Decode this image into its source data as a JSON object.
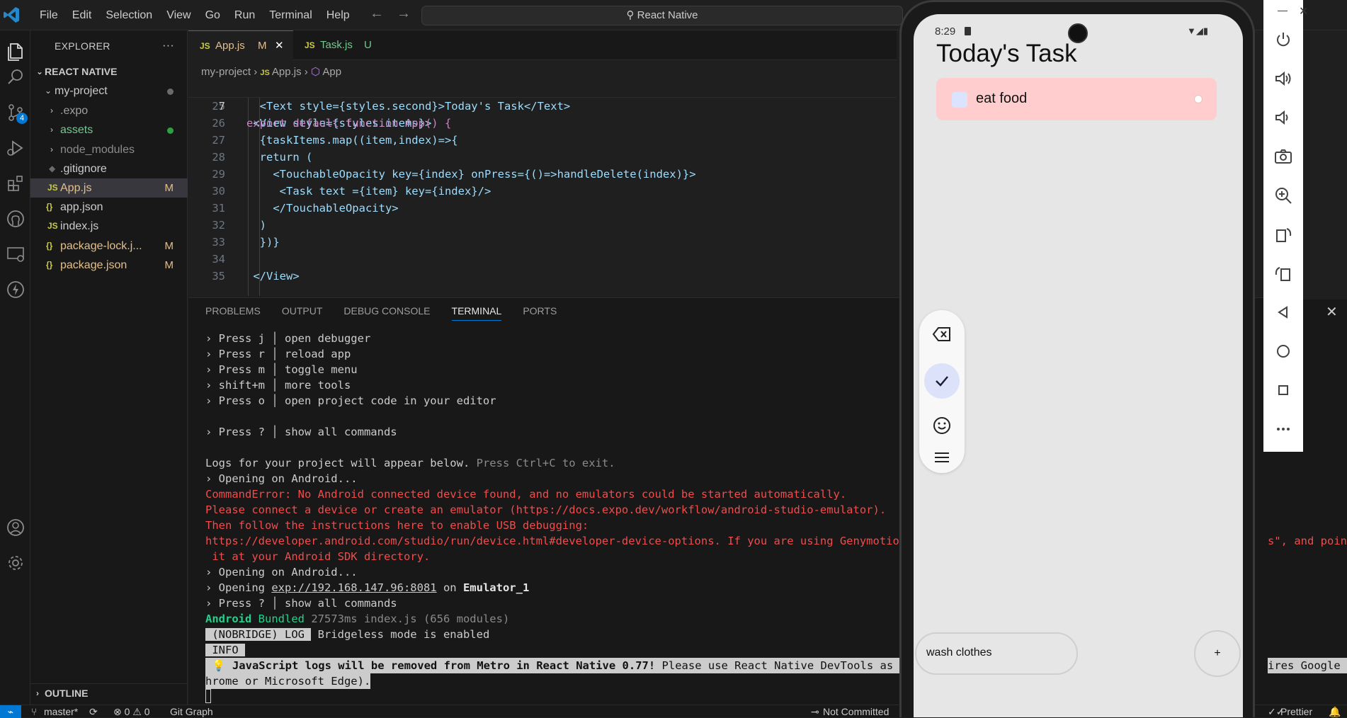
{
  "menu": [
    "File",
    "Edit",
    "Selection",
    "View",
    "Go",
    "Run",
    "Terminal",
    "Help"
  ],
  "command_center": "React Native",
  "activity": {
    "source_control_badge": "4"
  },
  "explorer": {
    "title": "EXPLORER",
    "more": "···",
    "root": "REACT NATIVE",
    "items": [
      {
        "label": "my-project",
        "kind": "folder-open"
      },
      {
        "label": ".expo",
        "kind": "folder"
      },
      {
        "label": "assets",
        "kind": "folder"
      },
      {
        "label": "node_modules",
        "kind": "folder"
      },
      {
        "label": ".gitignore",
        "kind": "file"
      },
      {
        "label": "App.js",
        "kind": "js",
        "badge": "M"
      },
      {
        "label": "app.json",
        "kind": "json"
      },
      {
        "label": "index.js",
        "kind": "js"
      },
      {
        "label": "package-lock.j...",
        "kind": "json",
        "badge": "M"
      },
      {
        "label": "package.json",
        "kind": "json",
        "badge": "M"
      }
    ],
    "outline": "OUTLINE"
  },
  "tabs": [
    {
      "label": "App.js",
      "badge": "M",
      "close": "✕"
    },
    {
      "label": "Task.js",
      "badge": "U"
    }
  ],
  "breadcrumb": {
    "folder": "my-project",
    "file": "App.js",
    "symbol": "App"
  },
  "sticky_line": {
    "num": "7",
    "text": "export default function App() {"
  },
  "code_lines": [
    {
      "num": "25",
      "text": "  <Text style={styles.second}>Today's Task</Text>"
    },
    {
      "num": "26",
      "text": " <View style={styles.items}>"
    },
    {
      "num": "27",
      "text": "  {taskItems.map((item,index)=>{"
    },
    {
      "num": "28",
      "text": "  return ("
    },
    {
      "num": "29",
      "text": "    <TouchableOpacity key={index} onPress={()=>handleDelete(index)}>"
    },
    {
      "num": "30",
      "text": "     <Task text ={item} key={index}/>"
    },
    {
      "num": "31",
      "text": "    </TouchableOpacity>"
    },
    {
      "num": "32",
      "text": "  )"
    },
    {
      "num": "33",
      "text": "  })}"
    },
    {
      "num": "34",
      "text": ""
    },
    {
      "num": "35",
      "text": " </View>"
    }
  ],
  "panel_tabs": [
    "PROBLEMS",
    "OUTPUT",
    "DEBUG CONSOLE",
    "TERMINAL",
    "PORTS"
  ],
  "terminal": {
    "press_j": "› Press j │ open debugger",
    "press_r": "› Press r │ reload app",
    "press_m": "› Press m │ toggle menu",
    "shift_m": "› shift+m │ more tools",
    "press_o": "› Press o │ open project code in your editor",
    "press_q": "› Press ? │ show all commands",
    "logs": "Logs for your project will appear below.",
    "logs_hint": " Press Ctrl+C to exit.",
    "opening1": "› Opening on Android...",
    "err1": "CommandError: No Android connected device found, and no emulators could be started automatically.",
    "err2": "Please connect a device or create an emulator (https://docs.expo.dev/workflow/android-studio-emulator).",
    "err3": "Then follow the instructions here to enable USB debugging:",
    "err4": "https://developer.android.com/studio/run/device.html#developer-device-options. If you are using Genymotion go",
    "err4_tail": "s\", and point",
    "err5": " it at your Android SDK directory.",
    "opening2": "› Opening on Android...",
    "opening3_a": "› Opening ",
    "opening3_url": "exp://192.168.147.96:8081",
    "opening3_b": " on ",
    "opening3_dev": "Emulator_1",
    "press_q2": "› Press ? │ show all commands",
    "bundled_a": "Android",
    "bundled_b": " Bundled",
    "bundled_c": " 27573ms index.js (656 modules)",
    "nobridge": " (NOBRIDGE) LOG ",
    "nobridge_msg": " Bridgeless mode is enabled",
    "info": " INFO ",
    "js_warn": " 💡 JavaScript logs will be removed from Metro in React Native 0.77!",
    "js_warn2": " Please use React Native DevTools as your",
    "js_warn_tail": "ires Google C",
    "js_warn3": "hrome or Microsoft Edge)."
  },
  "status": {
    "branch": "master*",
    "problems": "⊗ 0 ⚠ 0",
    "git_graph": "Git Graph",
    "not_committed": "Not Committed",
    "prettier": "Prettier"
  },
  "phone": {
    "time": "8:29",
    "title": "Today's Task",
    "tasks": [
      "eat food"
    ],
    "input_value": "wash clothes",
    "add_button": "+"
  }
}
